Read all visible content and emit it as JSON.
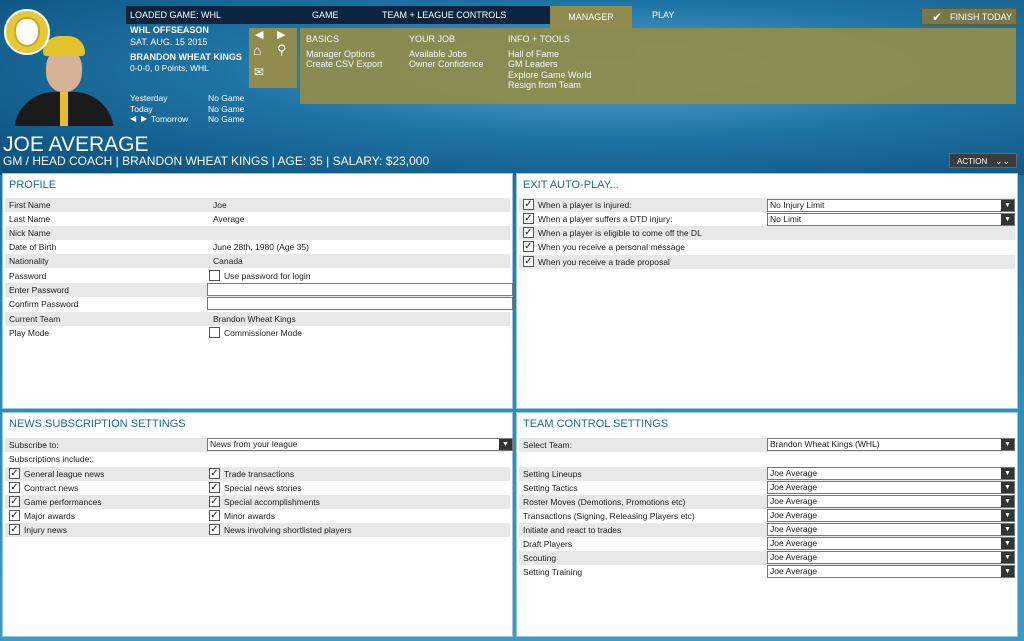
{
  "topbar": {
    "loaded_game": "LOADED GAME:  WHL",
    "game": "GAME",
    "team_league": "TEAM + LEAGUE CONTROLS",
    "manager": "MANAGER",
    "play": "PLAY",
    "finish_today": "FINISH TODAY"
  },
  "status": {
    "season": "WHL OFFSEASON",
    "date": "SAT. AUG. 15 2015",
    "team": "BRANDON WHEAT KINGS",
    "record": "0-0-0, 0 Points, WHL",
    "schedule": [
      {
        "day": "Yesterday",
        "game": "No Game"
      },
      {
        "day": "Today",
        "game": "No Game"
      },
      {
        "day": "Tomorrow",
        "game": "No Game"
      }
    ]
  },
  "menu": {
    "basics": {
      "title": "BASICS",
      "items": [
        "Manager Options",
        "Create CSV Export"
      ]
    },
    "your_job": {
      "title": "YOUR JOB",
      "items": [
        "Available Jobs",
        "Owner Confidence"
      ]
    },
    "info_tools": {
      "title": "INFO + TOOLS",
      "items": [
        "Hall of Fame",
        "GM Leaders",
        "Explore Game World",
        "Resign from Team"
      ]
    }
  },
  "header": {
    "name": "JOE AVERAGE",
    "subtitle": "GM / HEAD COACH | BRANDON WHEAT KINGS | AGE: 35 | SALARY: $23,000",
    "action": "ACTION"
  },
  "profile": {
    "title": "PROFILE",
    "first_name_label": "First Name",
    "first_name": "Joe",
    "last_name_label": "Last Name",
    "last_name": "Average",
    "nick_name_label": "Nick Name",
    "nick_name": "",
    "dob_label": "Date of Birth",
    "dob": "June 28th, 1980 (Age 35)",
    "nationality_label": "Nationality",
    "nationality": "Canada",
    "password_label": "Password",
    "password_option": "Use password for login",
    "enter_password_label": "Enter Password",
    "confirm_password_label": "Confirm Password",
    "current_team_label": "Current Team",
    "current_team": "Brandon Wheat Kings",
    "play_mode_label": "Play Mode",
    "play_mode_option": "Commissioner Mode"
  },
  "exit_autoplay": {
    "title": "EXIT AUTO-PLAY...",
    "items": [
      {
        "label": "When a player is injured:",
        "select": "No Injury Limit"
      },
      {
        "label": "When a player suffers a DTD injury:",
        "select": "No Limit"
      },
      {
        "label": "When a player is eligible to come off the DL",
        "select": ""
      },
      {
        "label": "When you receive a personal message",
        "select": ""
      },
      {
        "label": "When you receive a trade proposal",
        "select": ""
      }
    ]
  },
  "news": {
    "title": "NEWS SUBSCRIPTION SETTINGS",
    "subscribe_label": "Subscribe to:",
    "subscribe_value": "News from your league",
    "include_label": "Subscriptions include::",
    "left": [
      "General league news",
      "Contract news",
      "Game performances",
      "Major awards",
      "Injury news"
    ],
    "right": [
      "Trade  transactions",
      "Special news stories",
      "Special accomplishments",
      "Minor awards",
      "News involving shortlisted players"
    ]
  },
  "team_control": {
    "title": "TEAM CONTROL SETTINGS",
    "select_team_label": "Select Team:",
    "select_team_value": "Brandon Wheat Kings (WHL)",
    "rows": [
      {
        "label": "Setting Lineups",
        "value": "Joe Average"
      },
      {
        "label": "Setting Tactics",
        "value": "Joe Average"
      },
      {
        "label": "Roster Moves (Demotions, Promotions etc)",
        "value": "Joe Average"
      },
      {
        "label": "Transactions (Signing, Releasing Players etc)",
        "value": "Joe Average"
      },
      {
        "label": "Initiate and react to trades",
        "value": "Joe Average"
      },
      {
        "label": "Draft Players",
        "value": "Joe Average"
      },
      {
        "label": "Scouting",
        "value": "Joe Average"
      },
      {
        "label": "Setting Training",
        "value": "Joe Average"
      }
    ]
  }
}
